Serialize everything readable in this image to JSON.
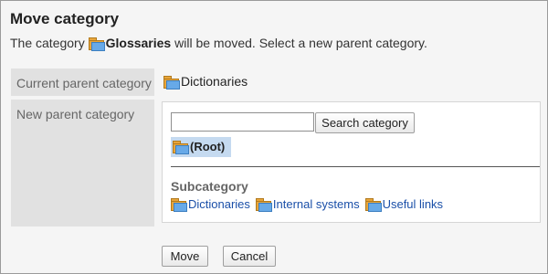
{
  "page": {
    "title": "Move category",
    "intro_prefix": "The category ",
    "category_name": "Glossaries",
    "intro_suffix": " will be moved. Select a new parent category."
  },
  "form": {
    "current_parent_label": "Current parent category",
    "current_parent_value": "Dictionaries",
    "new_parent_label": "New parent category"
  },
  "search": {
    "input_value": "",
    "placeholder": "",
    "button_label": "Search category"
  },
  "tree": {
    "root_label": "(Root)",
    "subcategory_heading": "Subcategory",
    "subcategories": [
      {
        "label": "Dictionaries"
      },
      {
        "label": "Internal systems"
      },
      {
        "label": "Useful links"
      }
    ]
  },
  "actions": {
    "move_label": "Move",
    "cancel_label": "Cancel"
  },
  "icons": {
    "folder": "folder-icon"
  },
  "colors": {
    "link": "#1a4fa8",
    "root_highlight": "#c5daf0",
    "label_background": "#e1e1e1",
    "folder_back": "#e8a53a",
    "folder_front": "#67a9e8"
  }
}
